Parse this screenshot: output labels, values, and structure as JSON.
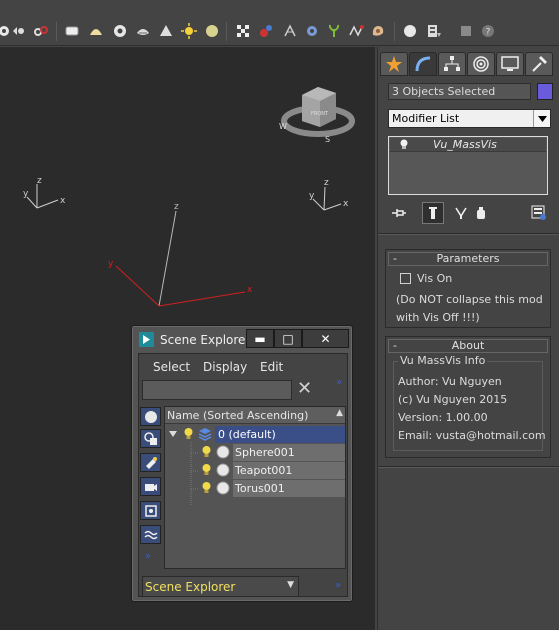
{
  "toolbar": {
    "icons": [
      "snap-toggle-icon",
      "link-icon",
      "box-primitive-icon",
      "dome-icon",
      "torus-icon",
      "cone-icon",
      "sun-icon",
      "sphere-icon",
      "checker-icon",
      "particle-icon",
      "paint-icon",
      "gear-icon",
      "plant-icon",
      "spline-icon",
      "shell-icon",
      "render-icon",
      "viewport-layout-icon",
      "help-icon"
    ]
  },
  "viewport": {
    "axis_x": "x",
    "axis_y": "y",
    "axis_z": "z",
    "viewcube": {
      "face": "FRONT",
      "compass_w": "W",
      "compass_s": "S"
    }
  },
  "command_panel": {
    "tabs": [
      "create-tab",
      "modify-tab",
      "hierarchy-tab",
      "motion-tab",
      "display-tab",
      "utilities-tab"
    ],
    "selection_text": "3 Objects Selected",
    "object_color": "#6a5adc",
    "modifier_list_label": "Modifier List",
    "stack": [
      {
        "name": "Vu_MassVis"
      }
    ],
    "parameters": {
      "title": "Parameters",
      "collapse_marker": "-",
      "vis_on_label": "Vis On",
      "vis_on_checked": false,
      "note_line1": "(Do NOT collapse this mod",
      "note_line2": "with Vis Off !!!)"
    },
    "about": {
      "title": "About",
      "collapse_marker": "-",
      "group_caption": "Vu MassVis Info",
      "author": "Author: Vu Nguyen",
      "copyright": "(c) Vu Nguyen 2015",
      "version": "Version: 1.00.00",
      "email": "Email: vusta@hotmail.com"
    }
  },
  "scene_explorer": {
    "title": "Scene Explore...",
    "menus": [
      "Select",
      "Display",
      "Edit"
    ],
    "column_header": "Name (Sorted Ascending)",
    "sort_indicator": "▲",
    "layer": {
      "name": "0 (default)",
      "expanded": true
    },
    "objects": [
      {
        "name": "Sphere001"
      },
      {
        "name": "Teapot001"
      },
      {
        "name": "Torus001"
      }
    ],
    "footer_selector": "Scene Explorer",
    "window_buttons": {
      "minimize": "▬",
      "maximize": "□",
      "close": "✕"
    }
  }
}
